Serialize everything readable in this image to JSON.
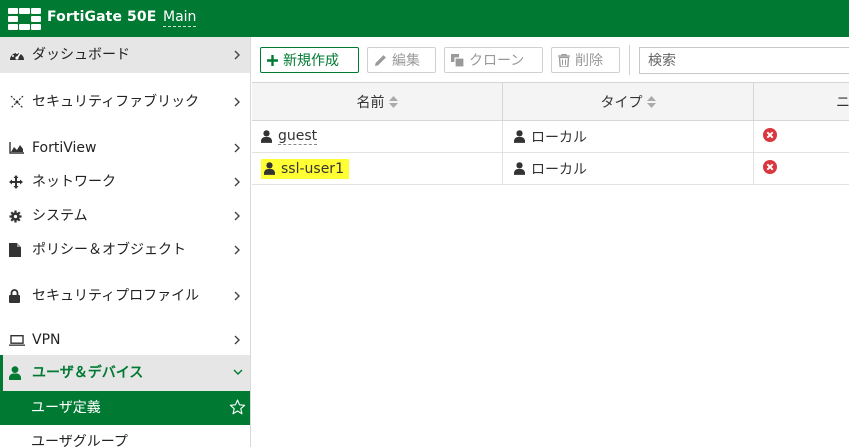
{
  "header": {
    "product": "FortiGate 50E",
    "vdom": "Main",
    "colors": {
      "brand": "#007a33"
    }
  },
  "sidebar": {
    "items": [
      {
        "label": "ダッシュボード",
        "icon": "dashboard-gauge-icon"
      },
      {
        "label": "セキュリティファブリック",
        "icon": "fabric-icon"
      },
      {
        "label": "FortiView",
        "icon": "area-chart-icon"
      },
      {
        "label": "ネットワーク",
        "icon": "arrows-move-icon"
      },
      {
        "label": "システム",
        "icon": "gear-icon"
      },
      {
        "label": "ポリシー＆オブジェクト",
        "icon": "document-icon"
      },
      {
        "label": "セキュリティプロファイル",
        "icon": "lock-icon"
      },
      {
        "label": "VPN",
        "icon": "laptop-icon"
      },
      {
        "label": "ユーザ＆デバイス",
        "icon": "user-icon",
        "expanded": true
      },
      {
        "label": "ユーザ定義",
        "selected": true
      },
      {
        "label": "ユーザグループ"
      }
    ]
  },
  "toolbar": {
    "new_label": "新規作成",
    "edit_label": "編集",
    "clone_label": "クローン",
    "delete_label": "削除",
    "search_placeholder": "検索"
  },
  "table": {
    "columns": [
      "名前",
      "タイプ",
      "ニ"
    ],
    "rows": [
      {
        "name": "guest",
        "type": "ローカル",
        "status": "disabled"
      },
      {
        "name": "ssl-user1",
        "type": "ローカル",
        "status": "disabled",
        "highlighted": true
      }
    ]
  }
}
